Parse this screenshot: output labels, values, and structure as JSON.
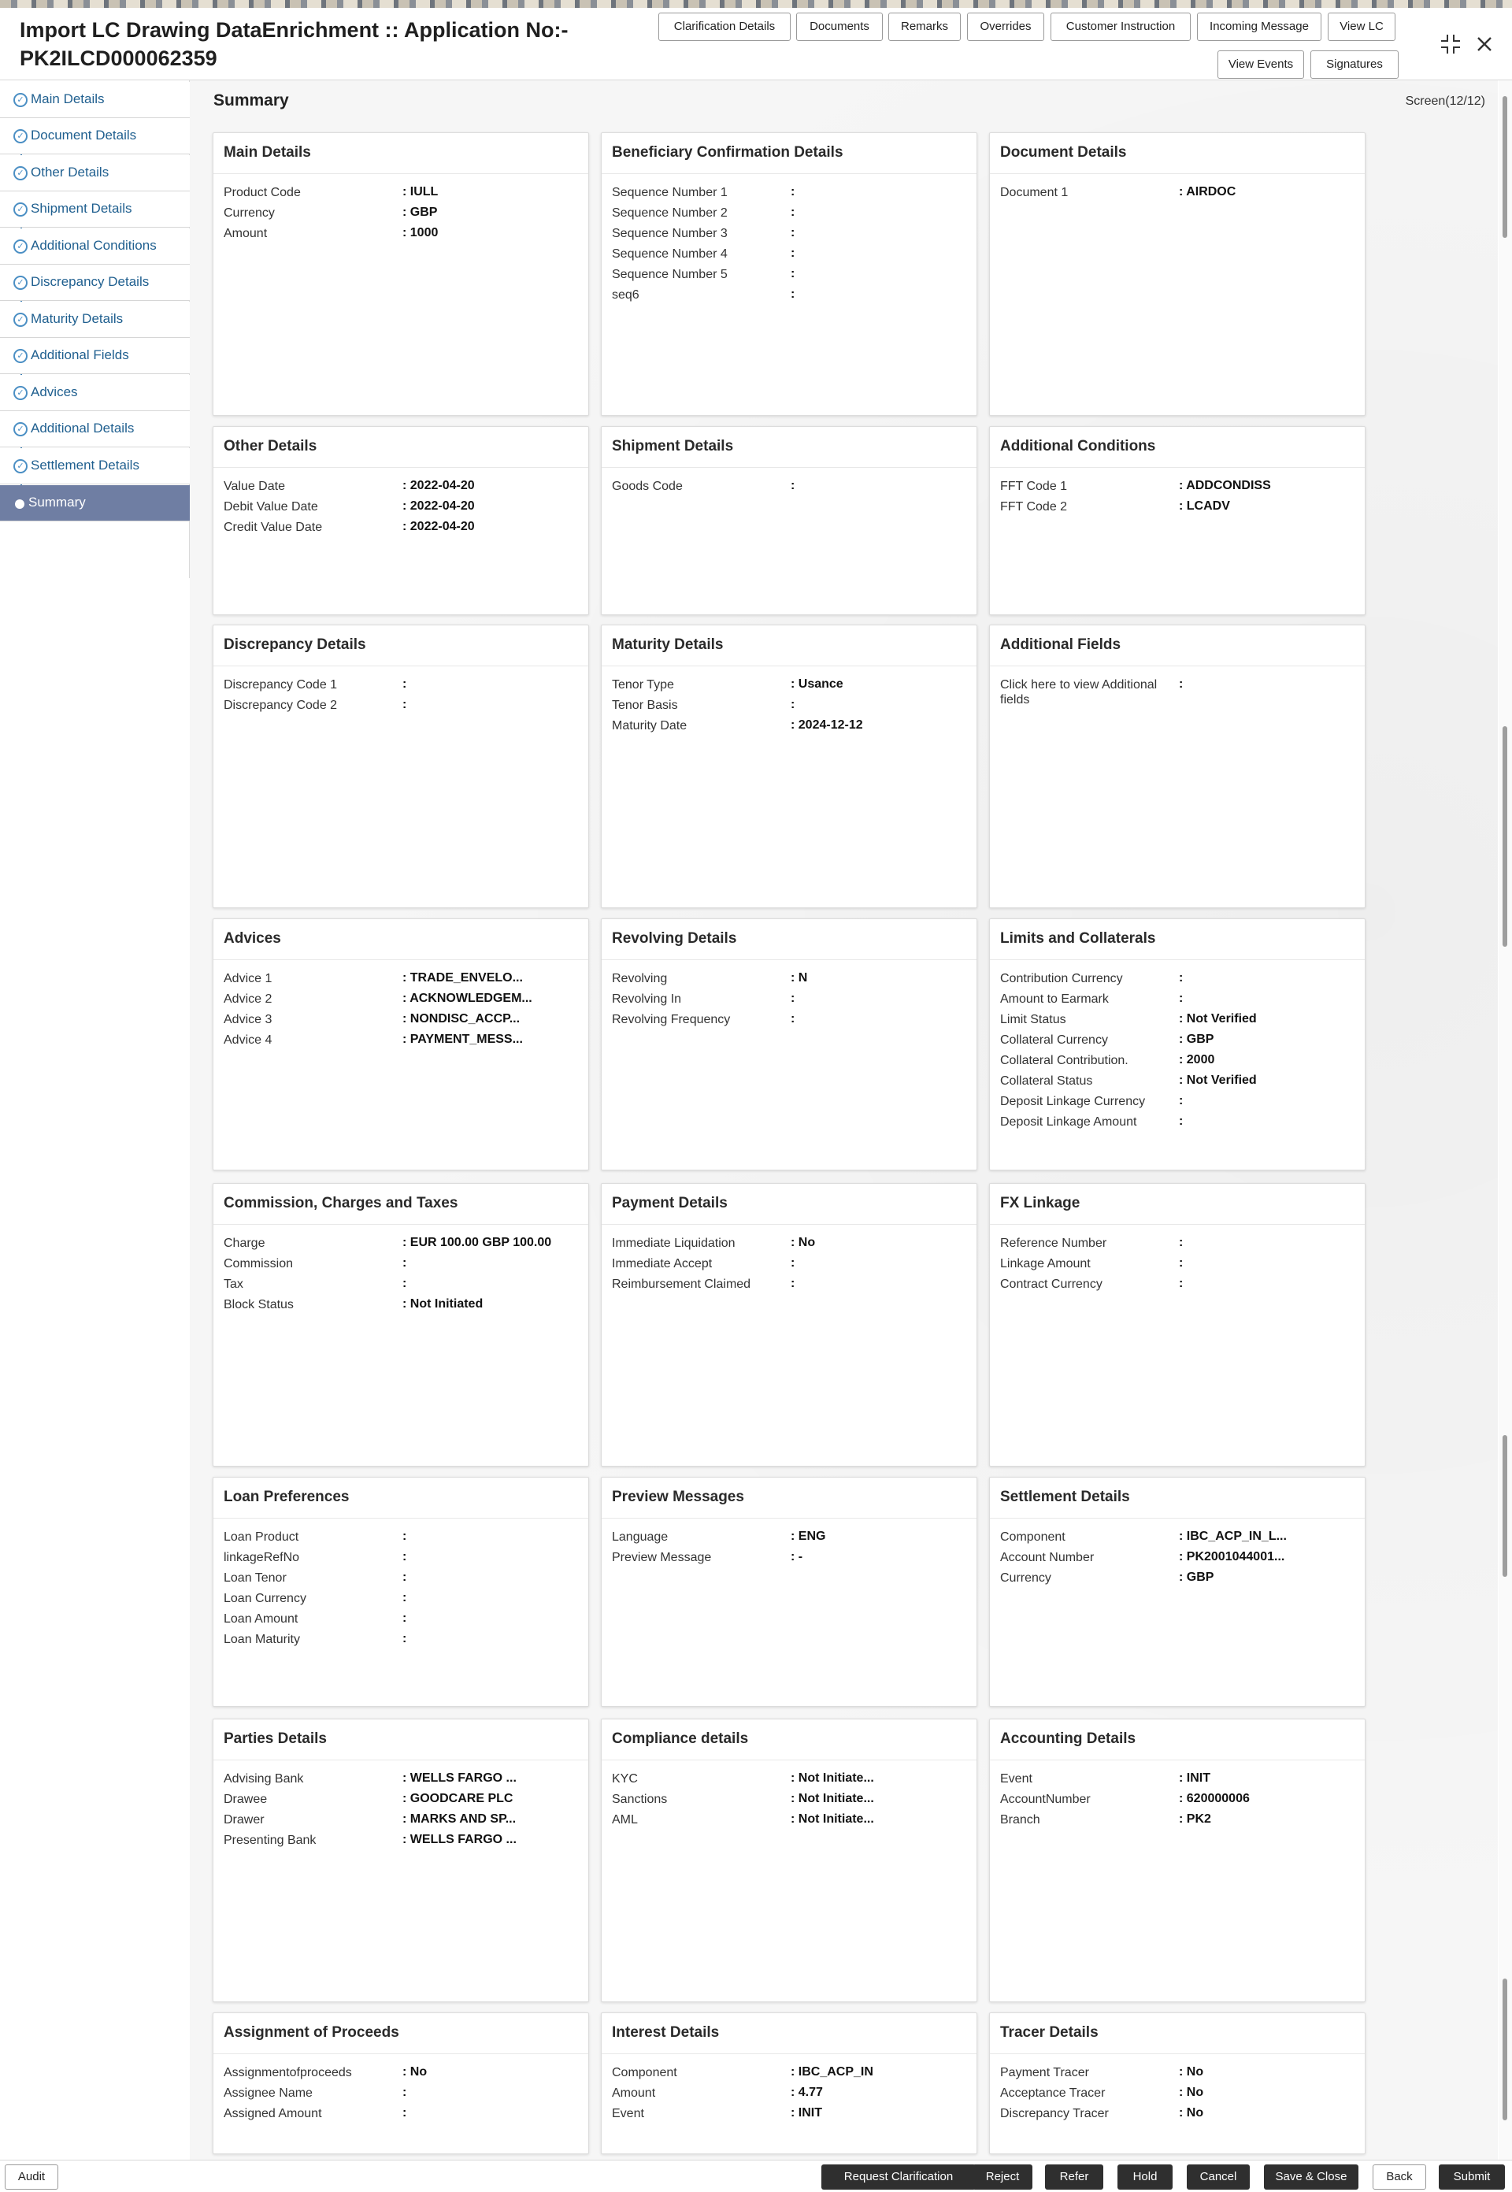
{
  "header": {
    "title": "Import LC Drawing DataEnrichment :: Application No:- PK2ILCD000062359",
    "buttons": [
      "Clarification Details",
      "Documents",
      "Remarks",
      "Overrides",
      "Customer Instruction",
      "Incoming Message",
      "View LC",
      "View Events",
      "Signatures"
    ],
    "icons": [
      "collapse-icon",
      "close-icon"
    ]
  },
  "sidebar": {
    "items": [
      {
        "label": "Main Details"
      },
      {
        "label": "Document Details"
      },
      {
        "label": "Other Details"
      },
      {
        "label": "Shipment Details"
      },
      {
        "label": "Additional Conditions"
      },
      {
        "label": "Discrepancy Details"
      },
      {
        "label": "Maturity Details"
      },
      {
        "label": "Additional Fields"
      },
      {
        "label": "Advices"
      },
      {
        "label": "Additional Details"
      },
      {
        "label": "Settlement Details"
      },
      {
        "label": "Summary"
      }
    ],
    "active": "Summary"
  },
  "main": {
    "title": "Summary",
    "screen": "Screen(12/12)"
  },
  "cards": [
    {
      "title": "Main Details",
      "rows": [
        [
          "Product Code",
          "IULL"
        ],
        [
          "Currency",
          "GBP"
        ],
        [
          "Amount",
          "1000"
        ]
      ]
    },
    {
      "title": "Beneficiary Confirmation Details",
      "rows": [
        [
          "Sequence Number 1",
          ""
        ],
        [
          "Sequence Number 2",
          ""
        ],
        [
          "Sequence Number 3",
          ""
        ],
        [
          "Sequence Number 4",
          ""
        ],
        [
          "Sequence Number 5",
          ""
        ],
        [
          "seq6",
          ""
        ]
      ]
    },
    {
      "title": "Document Details",
      "rows": [
        [
          "Document 1",
          "AIRDOC"
        ]
      ]
    },
    {
      "title": "Other Details",
      "rows": [
        [
          "Value Date",
          "2022-04-20"
        ],
        [
          "Debit Value Date",
          "2022-04-20"
        ],
        [
          "Credit Value Date",
          "2022-04-20"
        ]
      ]
    },
    {
      "title": "Shipment Details",
      "rows": [
        [
          "Goods Code",
          ""
        ]
      ]
    },
    {
      "title": "Additional Conditions",
      "rows": [
        [
          "FFT Code 1",
          "ADDCONDISS"
        ],
        [
          "FFT Code 2",
          "LCADV"
        ]
      ]
    },
    {
      "title": "Discrepancy Details",
      "rows": [
        [
          "Discrepancy Code 1",
          ""
        ],
        [
          "Discrepancy Code 2",
          ""
        ]
      ]
    },
    {
      "title": "Maturity Details",
      "rows": [
        [
          "Tenor Type",
          "Usance"
        ],
        [
          "Tenor Basis",
          ""
        ],
        [
          "Maturity Date",
          "2024-12-12"
        ]
      ]
    },
    {
      "title": "Additional Fields",
      "rows": [
        [
          "Click here to view Additional fields",
          ""
        ]
      ]
    },
    {
      "title": "Advices",
      "rows": [
        [
          "Advice 1",
          "TRADE_ENVELO..."
        ],
        [
          "Advice 2",
          "ACKNOWLEDGEM..."
        ],
        [
          "Advice 3",
          "NONDISC_ACCP..."
        ],
        [
          "Advice 4",
          "PAYMENT_MESS..."
        ]
      ]
    },
    {
      "title": "Revolving Details",
      "rows": [
        [
          "Revolving",
          "N"
        ],
        [
          "Revolving In",
          ""
        ],
        [
          "Revolving Frequency",
          ""
        ]
      ]
    },
    {
      "title": "Limits and Collaterals",
      "rows": [
        [
          "Contribution Currency",
          ""
        ],
        [
          "Amount to Earmark",
          ""
        ],
        [
          "Limit Status",
          "Not Verified"
        ],
        [
          "Collateral Currency",
          "GBP"
        ],
        [
          "Collateral Contribution.",
          "2000"
        ],
        [
          "Collateral Status",
          "Not Verified"
        ],
        [
          "Deposit Linkage Currency",
          ""
        ],
        [
          "Deposit Linkage Amount",
          ""
        ]
      ]
    },
    {
      "title": "Commission, Charges and Taxes",
      "rows": [
        [
          "Charge",
          "EUR  100.00 GBP  100.00"
        ],
        [
          "Commission",
          ""
        ],
        [
          "Tax",
          ""
        ],
        [
          "Block Status",
          "Not Initiated"
        ]
      ]
    },
    {
      "title": "Payment Details",
      "rows": [
        [
          "Immediate Liquidation",
          "No"
        ],
        [
          "Immediate Accept",
          ""
        ],
        [
          "Reimbursement Claimed",
          ""
        ]
      ]
    },
    {
      "title": "FX Linkage",
      "rows": [
        [
          "Reference Number",
          ""
        ],
        [
          "Linkage Amount",
          ""
        ],
        [
          "Contract Currency",
          ""
        ]
      ]
    },
    {
      "title": "Loan Preferences",
      "rows": [
        [
          "Loan Product",
          ""
        ],
        [
          "linkageRefNo",
          ""
        ],
        [
          "Loan Tenor",
          ""
        ],
        [
          "Loan Currency",
          ""
        ],
        [
          "Loan Amount",
          ""
        ],
        [
          "Loan Maturity",
          ""
        ]
      ]
    },
    {
      "title": "Preview Messages",
      "rows": [
        [
          "Language",
          "ENG"
        ],
        [
          "Preview Message",
          "-"
        ]
      ]
    },
    {
      "title": "Settlement Details",
      "rows": [
        [
          "Component",
          "IBC_ACP_IN_L..."
        ],
        [
          "Account Number",
          "PK2001044001..."
        ],
        [
          "Currency",
          "GBP"
        ]
      ]
    },
    {
      "title": "Parties Details",
      "rows": [
        [
          "Advising Bank",
          "WELLS FARGO ..."
        ],
        [
          "Drawee",
          "GOODCARE PLC"
        ],
        [
          "Drawer",
          "MARKS AND SP..."
        ],
        [
          "Presenting Bank",
          "WELLS FARGO ..."
        ]
      ]
    },
    {
      "title": "Compliance details",
      "rows": [
        [
          "KYC",
          "Not Initiate..."
        ],
        [
          "Sanctions",
          "Not Initiate..."
        ],
        [
          "AML",
          "Not Initiate..."
        ]
      ]
    },
    {
      "title": "Accounting Details",
      "rows": [
        [
          "Event",
          "INIT"
        ],
        [
          "AccountNumber",
          "620000006"
        ],
        [
          "Branch",
          "PK2"
        ]
      ]
    },
    {
      "title": "Assignment of Proceeds",
      "rows": [
        [
          "Assignmentofproceeds",
          "No"
        ],
        [
          "Assignee Name",
          ""
        ],
        [
          "Assigned Amount",
          ""
        ]
      ]
    },
    {
      "title": "Interest Details",
      "rows": [
        [
          "Component",
          "IBC_ACP_IN"
        ],
        [
          "Amount",
          "4.77"
        ],
        [
          "Event",
          "INIT"
        ]
      ]
    },
    {
      "title": "Tracer Details",
      "rows": [
        [
          "Payment Tracer",
          "No"
        ],
        [
          "Acceptance Tracer",
          "No"
        ],
        [
          "Discrepancy Tracer",
          "No"
        ]
      ]
    }
  ],
  "footer": {
    "audit": "Audit",
    "actions": [
      "Request Clarification",
      "Reject",
      "Refer",
      "Hold",
      "Cancel",
      "Save & Close",
      "Back",
      "Submit"
    ]
  }
}
